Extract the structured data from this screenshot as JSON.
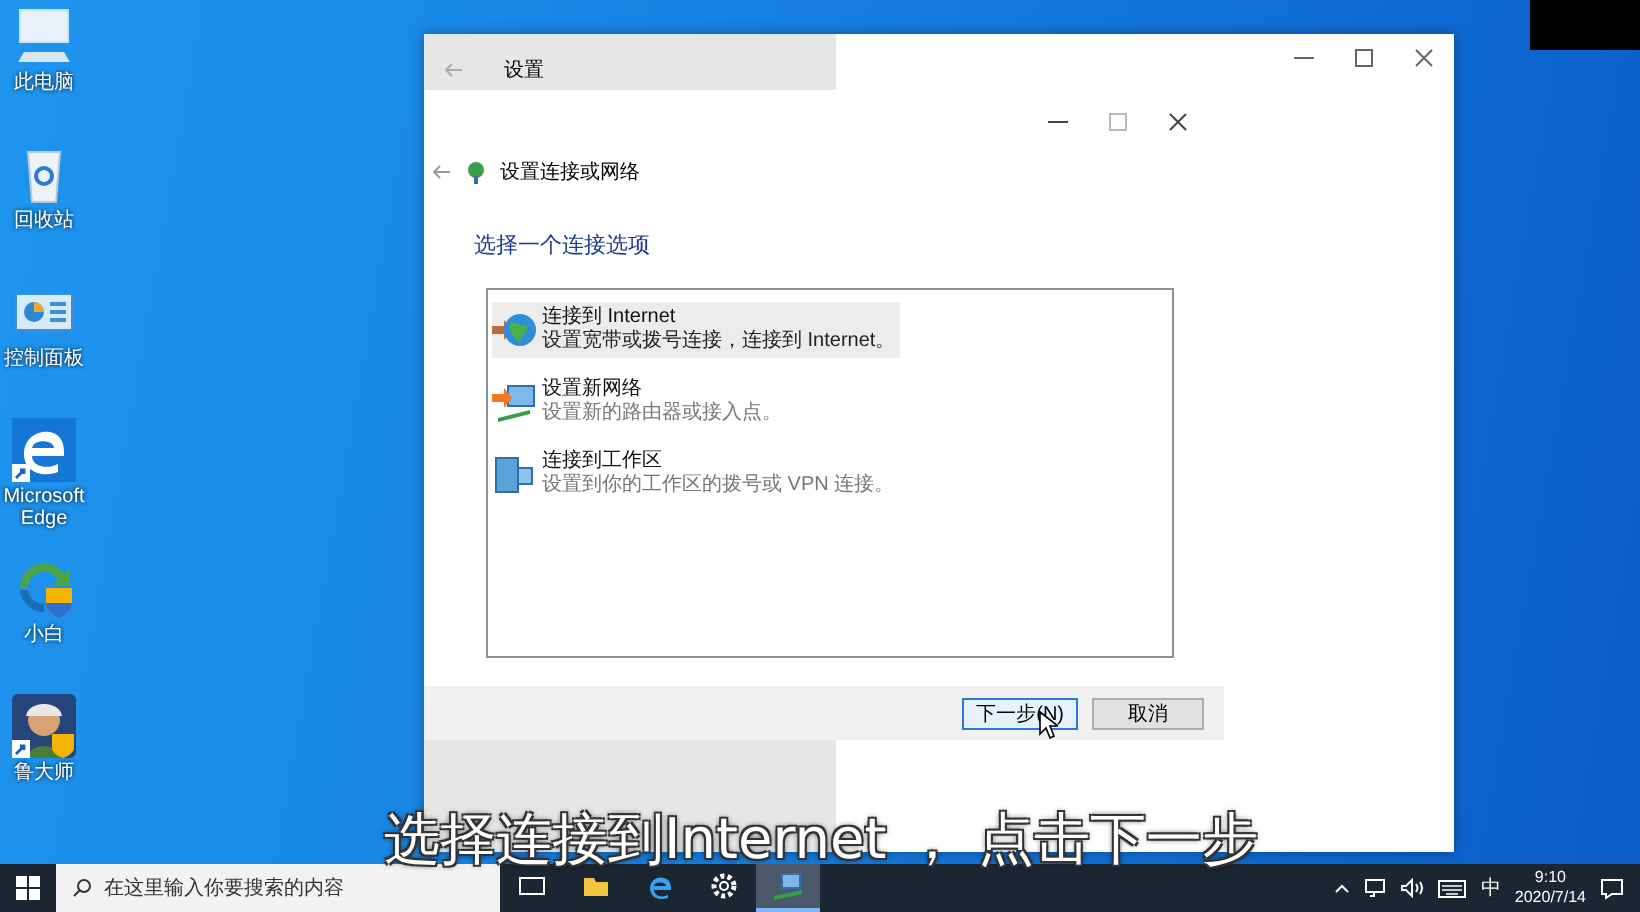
{
  "desktop_icons": [
    {
      "kind": "computer",
      "label": "此电脑",
      "shortcut": false
    },
    {
      "kind": "recycle-bin",
      "label": "回收站",
      "shortcut": false
    },
    {
      "kind": "control-panel",
      "label": "控制面板",
      "shortcut": false
    },
    {
      "kind": "edge",
      "label": "Microsoft Edge",
      "shortcut": true
    },
    {
      "kind": "xiaobai",
      "label": "小白",
      "shortcut": false
    },
    {
      "kind": "ludashi",
      "label": "鲁大师",
      "shortcut": true
    }
  ],
  "settings_window": {
    "title": "设置"
  },
  "dialog": {
    "title": "设置连接或网络",
    "heading": "选择一个连接选项",
    "options": [
      {
        "kind": "internet",
        "title": "连接到 Internet",
        "description": "设置宽带或拨号连接，连接到 Internet。",
        "selected": true
      },
      {
        "kind": "network",
        "title": "设置新网络",
        "description": "设置新的路由器或接入点。",
        "selected": false
      },
      {
        "kind": "workplace",
        "title": "连接到工作区",
        "description": "设置到你的工作区的拨号或 VPN 连接。",
        "selected": false
      }
    ],
    "buttons": [
      {
        "label": "下一步(N)",
        "default": true
      },
      {
        "label": "取消",
        "default": false
      }
    ]
  },
  "taskbar": {
    "search_placeholder": "在这里输入你要搜索的内容",
    "pinned": [
      {
        "kind": "task-view",
        "active": false
      },
      {
        "kind": "explorer",
        "active": false
      },
      {
        "kind": "edge",
        "active": false
      },
      {
        "kind": "settings",
        "active": false
      },
      {
        "kind": "network",
        "active": true
      }
    ],
    "ime": "中",
    "time": "9:10",
    "date": "2020/7/14"
  },
  "subtitle": "选择连接到Internet ， 点击下一步"
}
